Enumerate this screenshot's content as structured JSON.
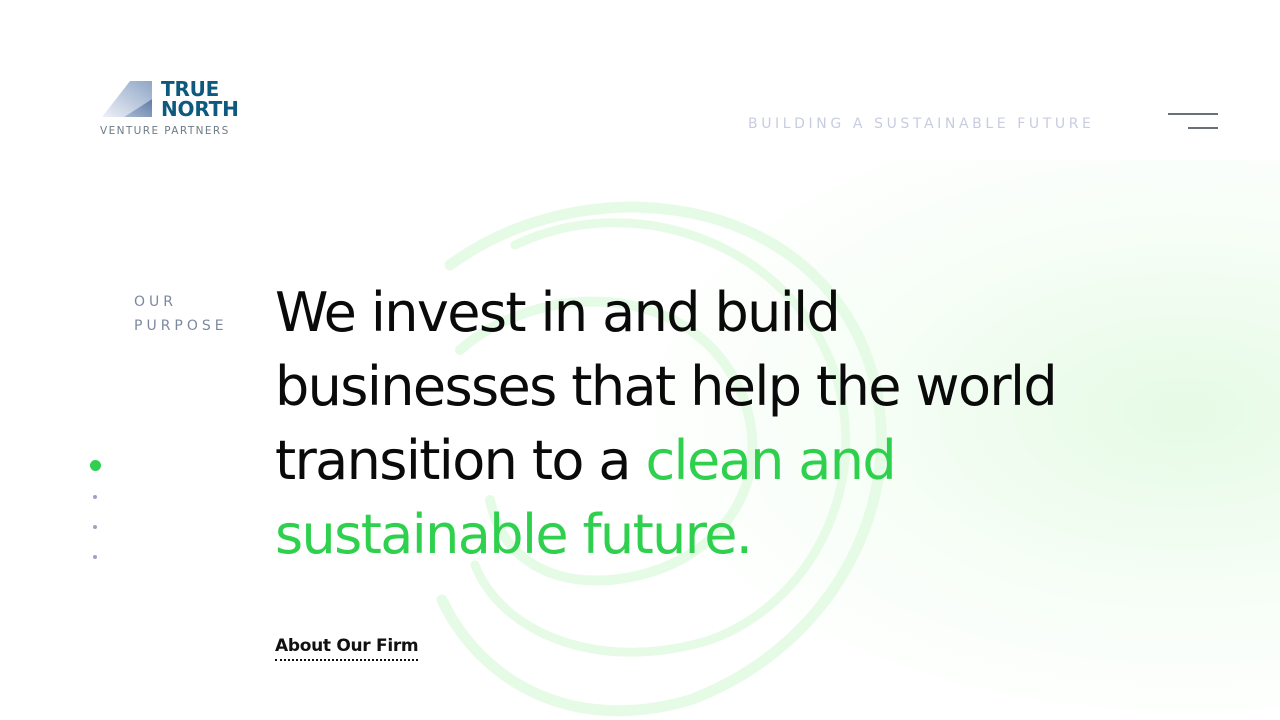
{
  "header": {
    "logo": {
      "line1": "TRUE",
      "line2": "NORTH",
      "subtitle": "VENTURE PARTNERS"
    },
    "tagline": "BUILDING A SUSTAINABLE FUTURE",
    "menu_icon": "hamburger-menu-icon"
  },
  "hero": {
    "section_label": [
      "OUR",
      "PURPOSE"
    ],
    "headline": {
      "line1": "We invest in and build",
      "line2": "businesses that help the world",
      "line3_plain": "transition to a ",
      "line3_highlight": "clean and",
      "line4_highlight": "sustainable future."
    },
    "cta_label": "About Our Firm"
  },
  "pagination": {
    "total": 4,
    "active_index": 0
  },
  "colors": {
    "accent_green": "#2fd04e",
    "logo_blue": "#0d5a7e",
    "text_dark": "#0a0a0a",
    "tagline_gray": "#c8cce0",
    "label_gray": "#7d88a0"
  }
}
